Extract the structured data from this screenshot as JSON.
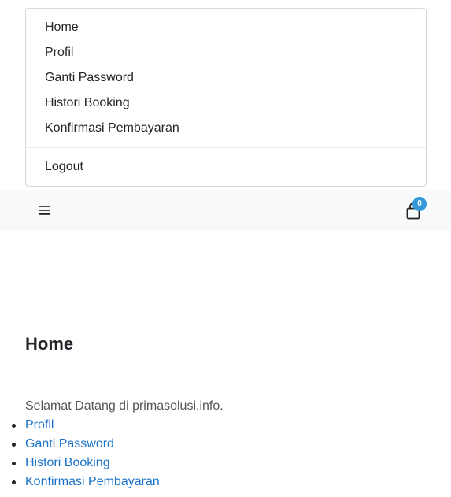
{
  "dropdown": {
    "items": [
      {
        "label": "Home"
      },
      {
        "label": "Profil"
      },
      {
        "label": "Ganti Password"
      },
      {
        "label": "Histori Booking"
      },
      {
        "label": "Konfirmasi Pembayaran"
      }
    ],
    "logout_label": "Logout"
  },
  "navbar": {
    "menu_icon": "hamburger-icon",
    "cart_icon": "shopping-bag-icon",
    "cart_count": "0",
    "badge_color": "#3498db"
  },
  "main": {
    "title": "Home",
    "welcome": "Selamat Datang di primasolusi.info.",
    "links": [
      {
        "label": "Profil"
      },
      {
        "label": "Ganti Password"
      },
      {
        "label": "Histori Booking"
      },
      {
        "label": "Konfirmasi Pembayaran"
      }
    ],
    "link_color": "#1a73c9"
  }
}
